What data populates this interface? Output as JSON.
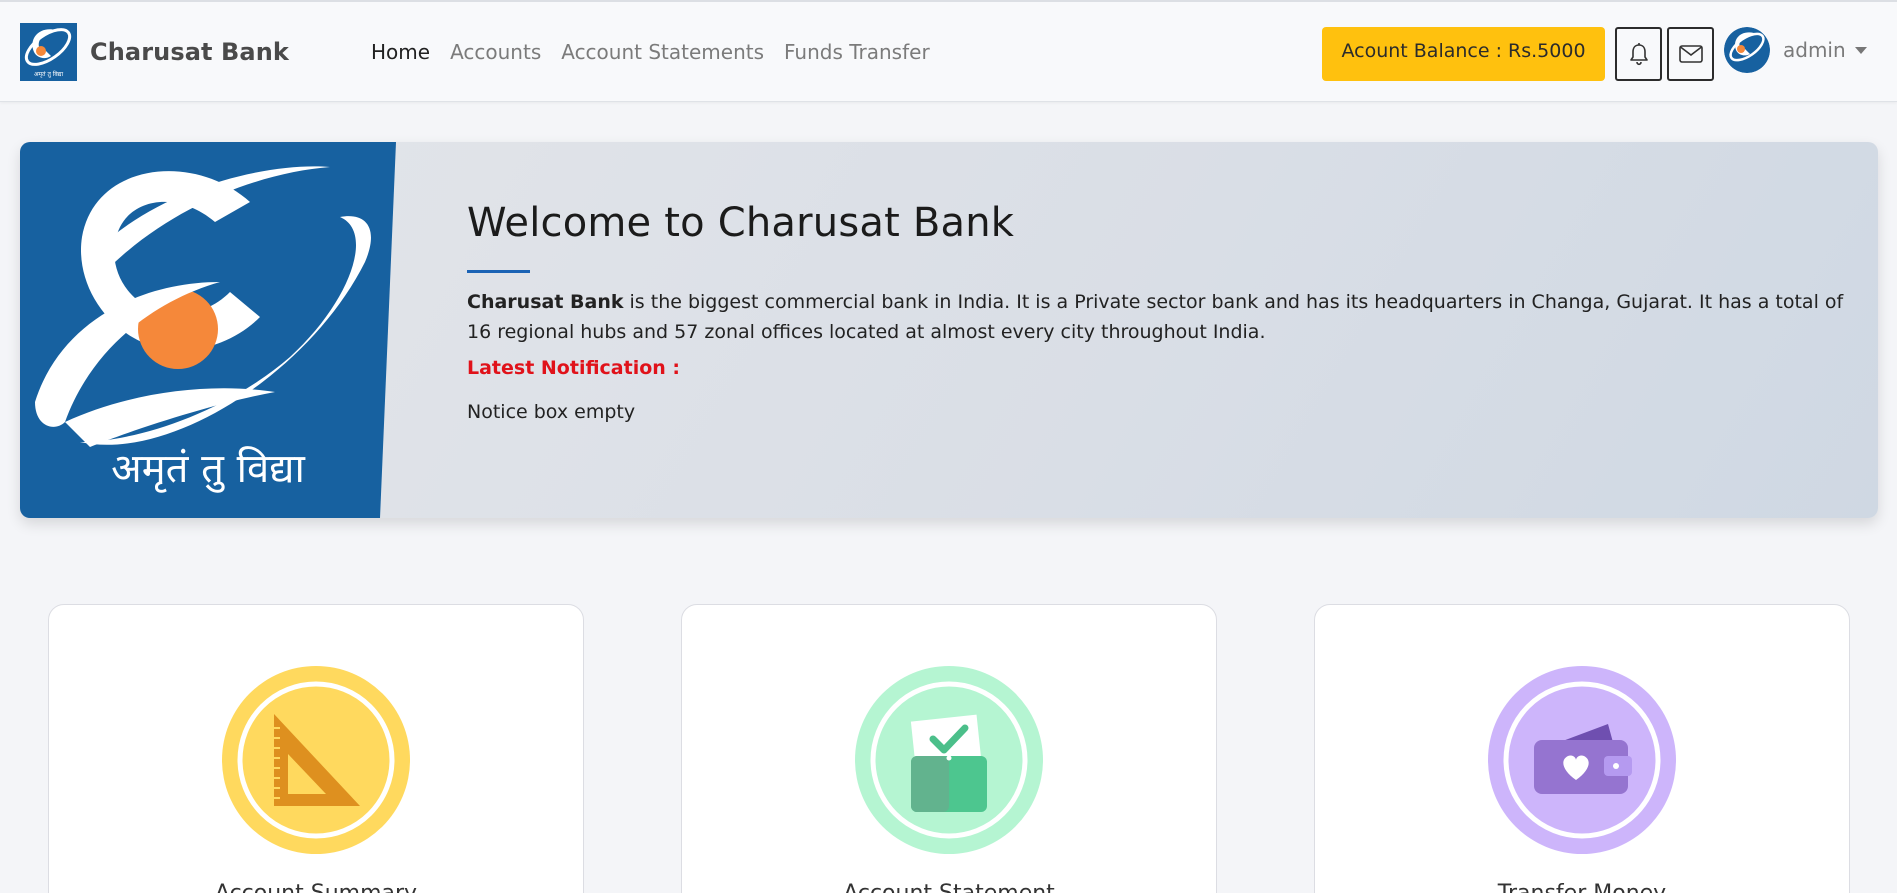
{
  "navbar": {
    "brand_name": "Charusat Bank",
    "brand_logo_caption": "अमृतं तु विद्या",
    "links": [
      {
        "label": "Home",
        "active": true
      },
      {
        "label": "Accounts",
        "active": false
      },
      {
        "label": "Account Statements",
        "active": false
      },
      {
        "label": "Funds Transfer",
        "active": false
      }
    ],
    "balance_label": "Acount Balance : Rs.5000",
    "bell_icon": "bell-icon",
    "mail_icon": "envelope-icon",
    "user_name": "admin"
  },
  "hero": {
    "logo_caption": "अमृतं तु विद्या",
    "title": "Welcome to Charusat Bank",
    "description_bold": "Charusat Bank",
    "description_rest": " is the biggest commercial bank in India. It is a Private sector bank and has its headquarters in Changa, Gujarat. It has a total of 16 regional hubs and 57 zonal offices located at almost every city throughout India.",
    "notification_label": "Latest Notification :",
    "notification_text": "Notice box empty"
  },
  "cards": [
    {
      "title": "Account Summary",
      "icon": "set-square-icon",
      "color": "#ffd95e"
    },
    {
      "title": "Account Statement",
      "icon": "wallet-check-icon",
      "color": "#b5f5d2"
    },
    {
      "title": "Transfer Money",
      "icon": "wallet-heart-icon",
      "color": "#cdb5fb"
    }
  ],
  "colors": {
    "balance_button": "#ffc10e",
    "logo_blue": "#1761a0",
    "sun_orange": "#f5883a",
    "notification_red": "#e0121a",
    "accent_rule": "#1b63b5"
  }
}
